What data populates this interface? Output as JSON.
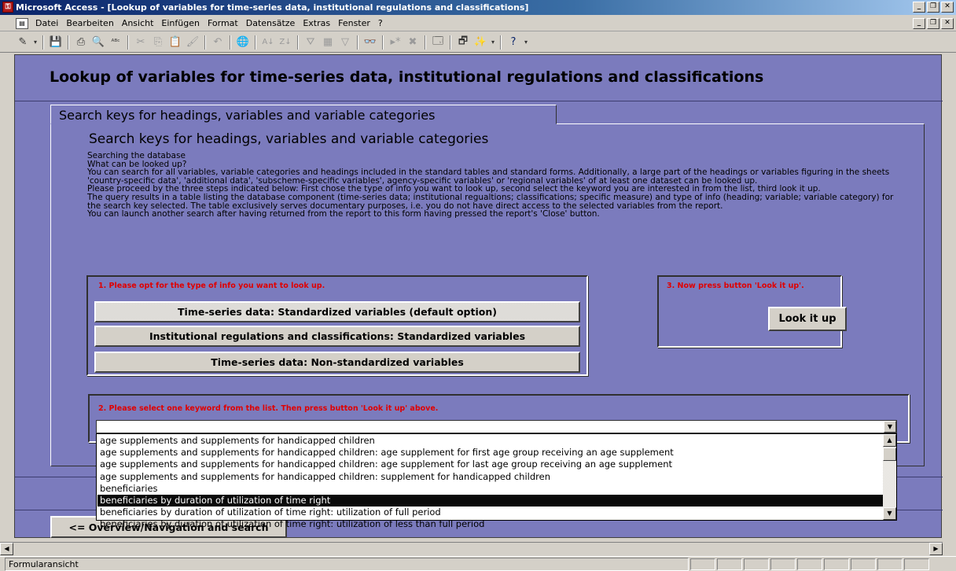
{
  "window": {
    "title": "Microsoft Access - [Lookup of variables for time-series data, institutional regulations and classifications]",
    "app_icon": "access-key-icon"
  },
  "menu": {
    "items": [
      "Datei",
      "Bearbeiten",
      "Ansicht",
      "Einfügen",
      "Format",
      "Datensätze",
      "Extras",
      "Fenster",
      "?"
    ]
  },
  "toolbar": {
    "icons": [
      "design-view-icon",
      "save-icon",
      "print-icon",
      "print-preview-icon",
      "spelling-icon",
      "cut-icon",
      "copy-icon",
      "paste-icon",
      "format-painter-icon",
      "undo-icon",
      "hyperlink-icon",
      "sort-ascending-icon",
      "sort-descending-icon",
      "filter-by-selection-icon",
      "filter-by-form-icon",
      "apply-filter-icon",
      "find-icon",
      "new-record-icon",
      "delete-record-icon",
      "properties-icon",
      "database-window-icon",
      "new-object-icon",
      "help-icon"
    ]
  },
  "form": {
    "title": "Lookup of variables for time-series data, institutional regulations and classifications",
    "tab_label": "Search keys for headings, variables and variable categories",
    "page_title": "Search keys for headings, variables and variable categories",
    "description": [
      "Searching the database",
      "What can be looked up?",
      "You can search for all variables, variable categories and headings included in the standard tables and standard forms. Additionally, a large part of the headings or variables figuring in the sheets 'country-specific data', 'additional data', 'subscheme-specific variables', agency-specific variables' or 'regional variables' of at least one dataset can be looked up.",
      "Please proceed by the three steps indicated below: First chose the type of info you want to look up, second select the keyword you are interested in from the list, third look it up.",
      "The query results in a table listing the database component (time-series data; institutional regualtions; classifications; specific measure) and type of info (heading; variable; variable category) for the search key selected. The table exclusively serves documentary purposes, i.e. you do not have direct access to the selected variables from the report.",
      "You can launch another search after having returned from the report to this form having pressed the report's 'Close' button."
    ],
    "step1_label": "1. Please opt for the type of info you want to look up.",
    "step1_options": [
      "Time-series data: Standardized variables (default option)",
      "Institutional regulations and classifications: Standardized variables",
      "Time-series data: Non-standardized variables"
    ],
    "step3_label": "3. Now press button 'Look it up'.",
    "lookup_button": "Look it up",
    "step2_label": "2. Please select one keyword from the list. Then press button 'Look it up' above.",
    "keyword_value": "",
    "keyword_options": [
      "age supplements and supplements for handicapped children",
      "age supplements and supplements for handicapped children: age supplement for first age group receiving an age supplement",
      "age supplements and supplements for handicapped children: age supplement for last age group receiving an age supplement",
      "age supplements and supplements for handicapped children: supplement for handicapped children",
      "beneficiaries",
      "beneficiaries by duration of utilization of time right",
      "beneficiaries by duration of utilization of time right: utilization of full period",
      "beneficiaries by duration of utilization of time right: utilization of less than full period"
    ],
    "selected_index": 5,
    "nav_button": "<= Overview/Navigation and search"
  },
  "status": {
    "text": "Formularansicht"
  }
}
